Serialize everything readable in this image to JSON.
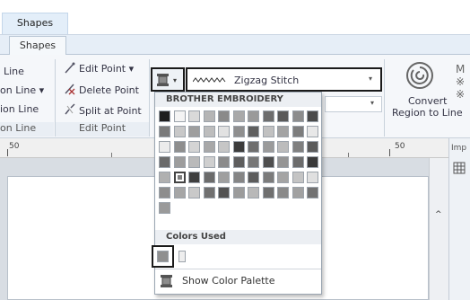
{
  "app": {
    "context_tab": "Shapes",
    "ribbon_tab": "Shapes"
  },
  "ribbon": {
    "left_items": [
      "Line",
      "on Line ▾",
      "ion Line"
    ],
    "left_group": "on Line",
    "edit_point": "Edit Point ▾",
    "delete_point": "Delete Point",
    "split_at_point": "Split at Point",
    "edit_point_group": "Edit Point",
    "stitch_type": "Zigzag Stitch",
    "convert_label_1": "Convert",
    "convert_label_2": "Region to Line"
  },
  "ruler": {
    "left_mark": "50",
    "right_mark": "50",
    "pane_label": "Imp"
  },
  "palette": {
    "header": "BROTHER EMBROIDERY",
    "colors_used_header": "Colors Used",
    "show_palette": "Show Color Palette",
    "rows": [
      [
        "#1e1e1e",
        "#f4f4f4",
        "#d9d9d9",
        "#b5b5b5",
        "#8a8a8a",
        "#a9a9a9",
        "#9a9a9a",
        "#6d6d6d",
        "#5a5a5a",
        "#8c8c8c",
        "#4a4a4a"
      ],
      [
        "#7a7a7a",
        "#c8c8c8",
        "#9e9e9e",
        "#bdbdbd",
        "#e2e2e2",
        "#8f8f8f",
        "#5f5f5f",
        "#c1c1c1",
        "#a3a3a3",
        "#7d7d7d",
        "#e8e8e8"
      ],
      [
        "#ececec",
        "#8e8e8e",
        "#d4d4d4",
        "#a8a8a8",
        "#c6c6c6",
        "#3c3c3c",
        "#6e6e6e",
        "#9b9b9b",
        "#bcbcbc",
        "#7f7f7f",
        "#5b5b5b"
      ],
      [
        "#6a6a6a",
        "#9d9d9d",
        "#bababa",
        "#cfcfcf",
        "#8b8b8b",
        "#5e5e5e",
        "#777777",
        "#4f4f4f",
        "#959595",
        "#6c6c6c",
        "#3a3a3a"
      ],
      [
        "#b0b0b0",
        "#7e7e7e",
        "#3f3f3f",
        "#6b6b6b",
        "#9f9f9f",
        "#858585",
        "#5c5c5c",
        "#7b7b7b",
        "#a4a4a4",
        "#c4c4c4",
        "#e0e0e0"
      ],
      [
        "#8d8d8d",
        "#a6a6a6",
        "#c9c9c9",
        "#707070",
        "#525252",
        "#9c9c9c",
        "#b8b8b8",
        "#6f6f6f",
        "#8a8a8a",
        "#a1a1a1",
        "#727272"
      ],
      [
        "#9a9a9a"
      ]
    ],
    "used_colors": [
      "#8f8f8f",
      "#eeeeee"
    ]
  }
}
